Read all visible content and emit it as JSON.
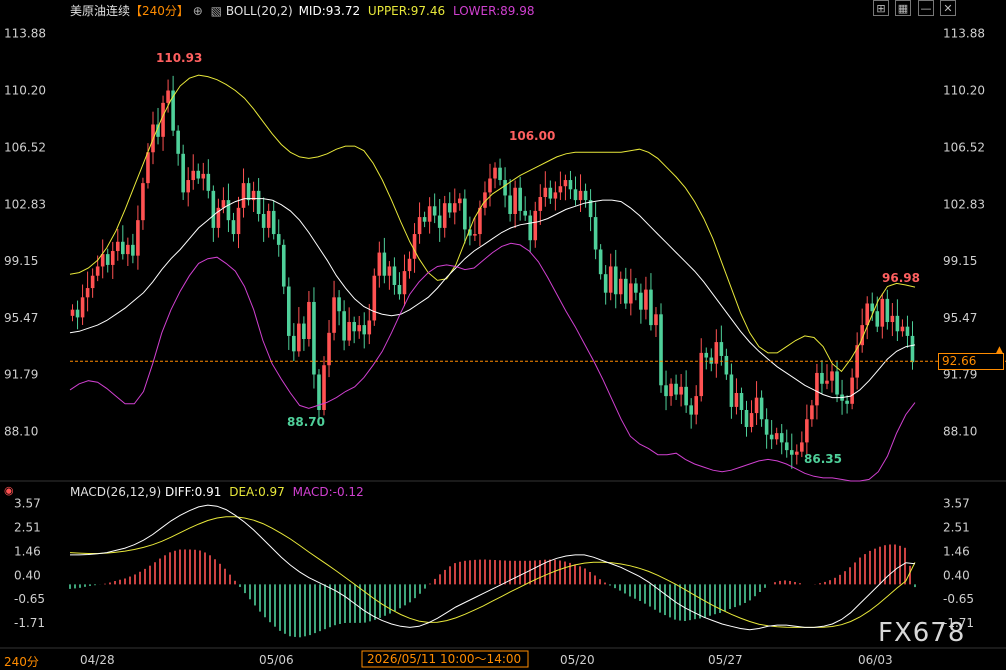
{
  "header": {
    "instrument": "美原油连续",
    "period_badge": "【240分】",
    "boll_label": "BOLL(20,2)",
    "mid_label": "MID:93.72",
    "upper_label": "UPPER:97.46",
    "lower_label": "LOWER:89.98"
  },
  "macd_header": {
    "title": "MACD(26,12,9)",
    "diff_label": "DIFF:0.91",
    "dea_label": "DEA:0.97",
    "macd_label": "MACD:-0.12"
  },
  "toolbar": {
    "btn1": "⊞",
    "btn2": "▦",
    "btn3": "—",
    "btn4": "✕"
  },
  "current_price": "92.66",
  "period_label": "240分",
  "crosshair_time": "2026/05/11 10:00～14:00",
  "watermark": "FX678",
  "colors": {
    "up": "#ff5252",
    "down": "#4fd09a",
    "mid": "#ffffff",
    "upper": "#e8e83a",
    "lower": "#d040d0",
    "dea": "#e8e83a",
    "diff": "#ffffff",
    "price_line": "#ff8c00"
  },
  "chart_data": [
    {
      "type": "candlestick",
      "title": "美原油连续 240分",
      "y_ticks": [
        113.88,
        110.2,
        106.52,
        102.83,
        99.15,
        95.47,
        91.79,
        88.1
      ],
      "ylim": [
        86.0,
        114.9
      ],
      "x_ticks": [
        "04/28",
        "05/06",
        "05/20",
        "05/27",
        "06/03"
      ],
      "annotations": [
        {
          "label": "110.93",
          "value": 110.93
        },
        {
          "label": "106.00",
          "value": 106.0
        },
        {
          "label": "88.70",
          "value": 88.7
        },
        {
          "label": "86.35",
          "value": 86.35
        },
        {
          "label": "96.98",
          "value": 96.98
        }
      ],
      "close": [
        96.0,
        95.5,
        96.8,
        97.4,
        98.2,
        98.8,
        99.6,
        98.9,
        99.8,
        100.4,
        99.6,
        100.2,
        99.5,
        101.8,
        104.2,
        106.2,
        108.0,
        107.2,
        109.4,
        110.2,
        107.6,
        106.1,
        103.6,
        104.4,
        105.0,
        104.5,
        104.8,
        103.7,
        101.3,
        102.6,
        103.1,
        101.8,
        100.9,
        102.6,
        104.2,
        103.1,
        103.7,
        102.2,
        101.3,
        102.4,
        100.9,
        100.2,
        97.5,
        94.3,
        93.3,
        95.1,
        94.1,
        96.5,
        91.8,
        89.5,
        92.4,
        94.5,
        96.8,
        95.9,
        94.0,
        95.2,
        94.6,
        95.0,
        94.4,
        95.3,
        98.2,
        99.7,
        98.2,
        98.8,
        97.6,
        97.0,
        98.5,
        99.3,
        100.9,
        102.0,
        101.7,
        102.7,
        102.1,
        101.3,
        102.9,
        102.3,
        102.9,
        103.2,
        101.2,
        100.8,
        100.9,
        102.6,
        103.6,
        104.5,
        105.2,
        104.4,
        103.4,
        102.2,
        103.9,
        102.4,
        102.1,
        100.5,
        102.4,
        103.3,
        103.9,
        103.2,
        103.6,
        104.0,
        104.4,
        103.8,
        103.1,
        103.7,
        103.1,
        102.0,
        99.9,
        98.3,
        97.1,
        98.8,
        97.0,
        98.0,
        96.4,
        97.7,
        97.1,
        96.0,
        97.3,
        95.0,
        95.7,
        91.1,
        90.4,
        91.2,
        90.5,
        91.0,
        89.8,
        89.2,
        90.4,
        93.2,
        92.9,
        92.5,
        93.9,
        93.0,
        91.8,
        89.7,
        90.6,
        89.5,
        88.4,
        89.3,
        90.3,
        88.9,
        87.9,
        87.6,
        88.0,
        87.4,
        86.9,
        86.6,
        86.8,
        87.4,
        88.9,
        89.8,
        91.9,
        91.2,
        91.4,
        92.0,
        90.5,
        90.1,
        89.9,
        91.6,
        93.7,
        95.0,
        96.4,
        95.9,
        94.9,
        96.7,
        95.2,
        95.6,
        94.6,
        94.9,
        94.3,
        92.6
      ],
      "mid": [
        94.5,
        94.6,
        94.8,
        95.0,
        95.3,
        95.7,
        96.1,
        96.6,
        97.1,
        97.8,
        98.6,
        99.3,
        99.9,
        100.6,
        101.3,
        101.8,
        102.3,
        102.7,
        103.0,
        103.2,
        103.2,
        103.2,
        103.1,
        102.8,
        102.4,
        101.8,
        101.0,
        100.1,
        99.2,
        98.2,
        97.4,
        96.7,
        96.2,
        95.9,
        95.7,
        95.6,
        95.7,
        96.0,
        96.4,
        96.8,
        97.4,
        98.1,
        98.7,
        99.3,
        99.8,
        100.2,
        100.6,
        101.0,
        101.3,
        101.5,
        101.6,
        101.7,
        101.9,
        102.2,
        102.5,
        102.7,
        102.9,
        103.0,
        103.1,
        103.1,
        103.0,
        102.6,
        102.1,
        101.5,
        100.9,
        100.3,
        99.7,
        99.1,
        98.5,
        97.8,
        97.0,
        96.2,
        95.4,
        94.6,
        93.9,
        93.3,
        92.8,
        92.3,
        91.9,
        91.5,
        91.1,
        90.8,
        90.5,
        90.3,
        90.3,
        90.4,
        90.8,
        91.4,
        92.1,
        92.8,
        93.3,
        93.6,
        93.72
      ],
      "upper": [
        98.3,
        98.4,
        98.7,
        99.2,
        100.0,
        101.1,
        102.5,
        104.0,
        105.5,
        107.0,
        108.4,
        109.6,
        110.5,
        111.0,
        111.2,
        111.1,
        110.9,
        110.6,
        110.2,
        109.7,
        109.0,
        108.2,
        107.4,
        106.7,
        106.2,
        105.9,
        105.8,
        105.9,
        106.1,
        106.4,
        106.6,
        106.6,
        106.3,
        105.5,
        104.4,
        103.1,
        101.7,
        100.4,
        99.3,
        98.4,
        97.9,
        98.0,
        98.9,
        100.4,
        101.9,
        102.9,
        103.5,
        103.9,
        104.3,
        104.7,
        105.0,
        105.3,
        105.6,
        105.9,
        106.1,
        106.2,
        106.2,
        106.2,
        106.2,
        106.2,
        106.2,
        106.3,
        106.4,
        106.2,
        105.8,
        105.2,
        104.6,
        103.9,
        103.0,
        101.9,
        100.6,
        99.0,
        97.4,
        95.8,
        94.5,
        93.6,
        93.2,
        93.2,
        93.6,
        94.0,
        94.3,
        94.2,
        93.6,
        92.5,
        92.0,
        92.8,
        93.8,
        95.2,
        96.6,
        97.5,
        97.7,
        97.6,
        97.46
      ],
      "lower": [
        90.8,
        91.2,
        91.4,
        91.3,
        90.9,
        90.4,
        89.9,
        89.9,
        90.7,
        92.5,
        94.5,
        96.0,
        97.2,
        98.2,
        99.0,
        99.3,
        99.4,
        99.0,
        98.5,
        97.5,
        96.0,
        94.0,
        92.5,
        91.5,
        90.6,
        89.8,
        89.6,
        89.8,
        90.0,
        90.3,
        90.7,
        91.0,
        91.6,
        92.4,
        93.3,
        94.5,
        95.8,
        97.0,
        97.8,
        98.4,
        98.8,
        98.9,
        98.8,
        98.6,
        98.7,
        99.2,
        99.7,
        100.1,
        100.3,
        100.2,
        99.8,
        99.1,
        98.1,
        97.0,
        95.9,
        94.9,
        93.8,
        92.7,
        91.5,
        90.2,
        88.9,
        87.8,
        87.3,
        87.0,
        86.6,
        86.6,
        86.7,
        86.3,
        86.0,
        85.8,
        85.6,
        85.5,
        85.6,
        85.8,
        86.0,
        86.2,
        86.3,
        86.2,
        86.0,
        85.7,
        85.4,
        85.2,
        85.1,
        85.1,
        85.0,
        84.9,
        84.9,
        85.0,
        85.5,
        86.5,
        88.0,
        89.2,
        89.98
      ]
    },
    {
      "type": "macd",
      "title": "MACD(26,12,9)",
      "y_ticks": [
        3.57,
        2.51,
        1.46,
        0.4,
        -0.65,
        -1.71
      ],
      "ylim": [
        -2.5,
        3.9
      ],
      "diff": [
        1.3,
        1.3,
        1.32,
        1.35,
        1.4,
        1.5,
        1.6,
        1.75,
        1.95,
        2.2,
        2.5,
        2.8,
        3.05,
        3.25,
        3.42,
        3.5,
        3.45,
        3.3,
        3.05,
        2.75,
        2.4,
        2.0,
        1.6,
        1.2,
        0.85,
        0.55,
        0.3,
        0.1,
        -0.1,
        -0.3,
        -0.55,
        -0.85,
        -1.15,
        -1.4,
        -1.6,
        -1.75,
        -1.85,
        -1.9,
        -1.85,
        -1.7,
        -1.5,
        -1.25,
        -1.0,
        -0.8,
        -0.6,
        -0.4,
        -0.2,
        0.0,
        0.2,
        0.4,
        0.6,
        0.8,
        1.0,
        1.15,
        1.25,
        1.3,
        1.3,
        1.2,
        1.05,
        0.9,
        0.75,
        0.55,
        0.35,
        0.1,
        -0.2,
        -0.5,
        -0.8,
        -1.05,
        -1.25,
        -1.45,
        -1.6,
        -1.75,
        -1.85,
        -1.95,
        -2.0,
        -1.95,
        -1.85,
        -1.8,
        -1.8,
        -1.85,
        -1.9,
        -1.9,
        -1.85,
        -1.75,
        -1.55,
        -1.25,
        -0.85,
        -0.45,
        -0.05,
        0.35,
        0.7,
        0.95,
        0.91
      ],
      "dea": [
        1.4,
        1.38,
        1.36,
        1.36,
        1.38,
        1.42,
        1.47,
        1.54,
        1.63,
        1.75,
        1.9,
        2.08,
        2.28,
        2.48,
        2.66,
        2.82,
        2.93,
        2.98,
        2.98,
        2.93,
        2.83,
        2.68,
        2.48,
        2.25,
        2.0,
        1.72,
        1.43,
        1.15,
        0.87,
        0.59,
        0.3,
        0.0,
        -0.3,
        -0.6,
        -0.88,
        -1.12,
        -1.33,
        -1.5,
        -1.62,
        -1.68,
        -1.67,
        -1.6,
        -1.48,
        -1.32,
        -1.14,
        -0.95,
        -0.74,
        -0.53,
        -0.32,
        -0.12,
        0.08,
        0.27,
        0.45,
        0.61,
        0.75,
        0.86,
        0.94,
        0.98,
        0.98,
        0.95,
        0.9,
        0.82,
        0.71,
        0.57,
        0.4,
        0.2,
        -0.01,
        -0.24,
        -0.48,
        -0.71,
        -0.93,
        -1.13,
        -1.32,
        -1.49,
        -1.64,
        -1.76,
        -1.83,
        -1.87,
        -1.89,
        -1.9,
        -1.9,
        -1.9,
        -1.89,
        -1.86,
        -1.78,
        -1.64,
        -1.44,
        -1.18,
        -0.87,
        -0.53,
        -0.18,
        0.15,
        0.97
      ]
    }
  ],
  "x_labels": [
    "04/28",
    "05/06",
    "05/20",
    "05/27",
    "06/03"
  ]
}
